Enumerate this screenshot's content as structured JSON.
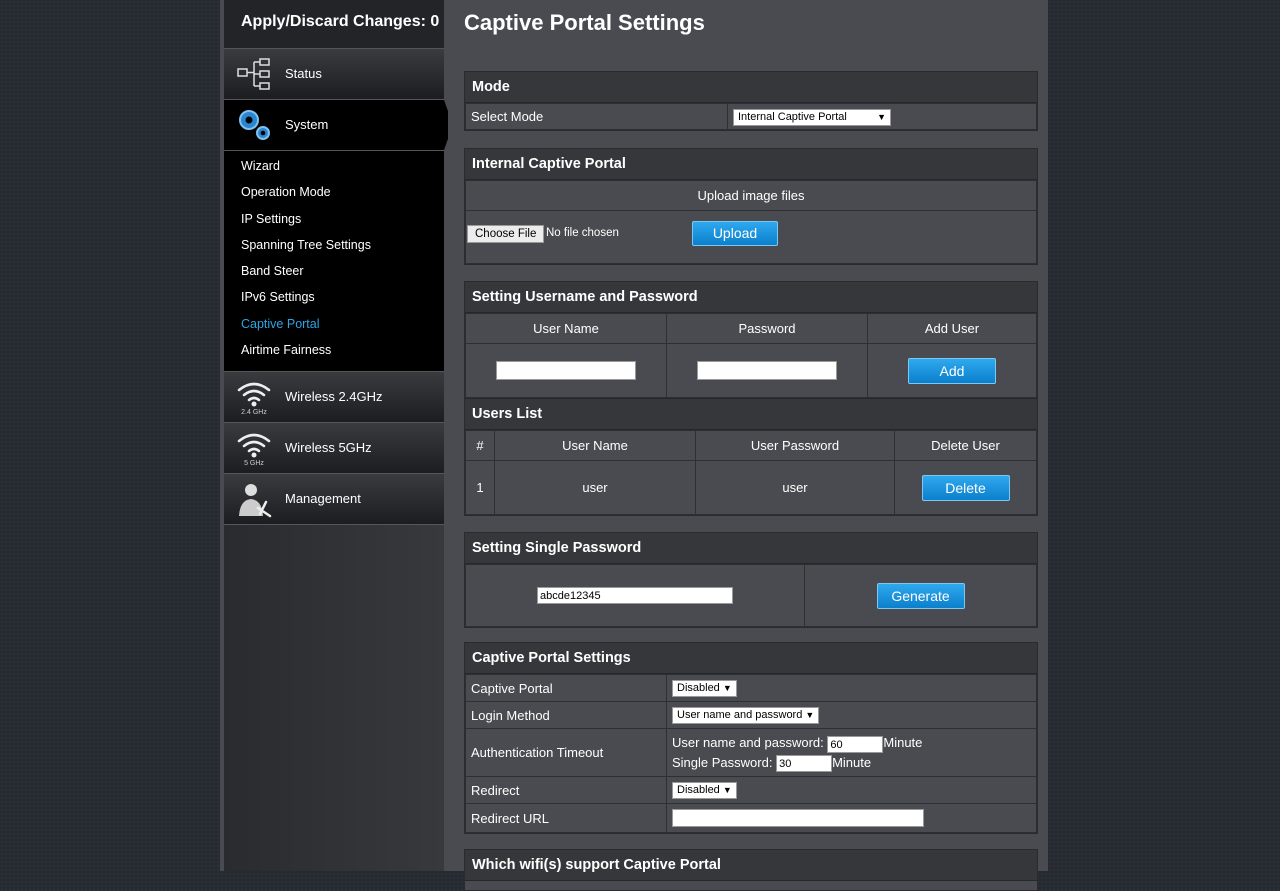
{
  "sidebar": {
    "apply_label": "Apply/Discard Changes: 0",
    "status_label": "Status",
    "system_label": "System",
    "sub_items": [
      "Wizard",
      "Operation Mode",
      "IP Settings",
      "Spanning Tree Settings",
      "Band Steer",
      "IPv6 Settings",
      "Captive Portal",
      "Airtime Fairness"
    ],
    "wireless24_label": "Wireless 2.4GHz",
    "wireless24_badge": "2.4 GHz",
    "wireless5_label": "Wireless 5GHz",
    "wireless5_badge": "5 GHz",
    "management_label": "Management",
    "active_color": "#2ea3e6"
  },
  "page": {
    "title": "Captive Portal Settings"
  },
  "mode": {
    "header": "Mode",
    "select_label": "Select Mode",
    "select_value": "Internal Captive Portal"
  },
  "internal": {
    "header": "Internal Captive Portal",
    "upload_title": "Upload image files",
    "choose_file": "Choose File",
    "no_file": "No file chosen",
    "upload_button": "Upload"
  },
  "userpass": {
    "header": "Setting Username and Password",
    "col_user": "User Name",
    "col_pass": "Password",
    "col_add": "Add User",
    "username_value": "",
    "password_value": "",
    "add_button": "Add"
  },
  "users_list": {
    "header": "Users List",
    "col_num": "#",
    "col_user": "User Name",
    "col_pass": "User Password",
    "col_delete": "Delete User",
    "rows": [
      {
        "num": "1",
        "user": "user",
        "password": "user",
        "delete_label": "Delete"
      }
    ]
  },
  "single": {
    "header": "Setting Single Password",
    "password_value": "abcde12345",
    "generate_button": "Generate"
  },
  "portal_settings": {
    "header": "Captive Portal Settings",
    "captive_label": "Captive Portal",
    "captive_value": "Disabled",
    "login_label": "Login Method",
    "login_value": "User name and password",
    "timeout_label": "Authentication Timeout",
    "timeout_user_label": "User name and password:",
    "timeout_user_value": "60",
    "timeout_single_label": "Single Password:",
    "timeout_single_value": "30",
    "minute_label": "Minute",
    "redirect_label": "Redirect",
    "redirect_value": "Disabled",
    "redirect_url_label": "Redirect URL",
    "redirect_url_value": ""
  },
  "wifi_support": {
    "header": "Which wifi(s) support Captive Portal"
  }
}
